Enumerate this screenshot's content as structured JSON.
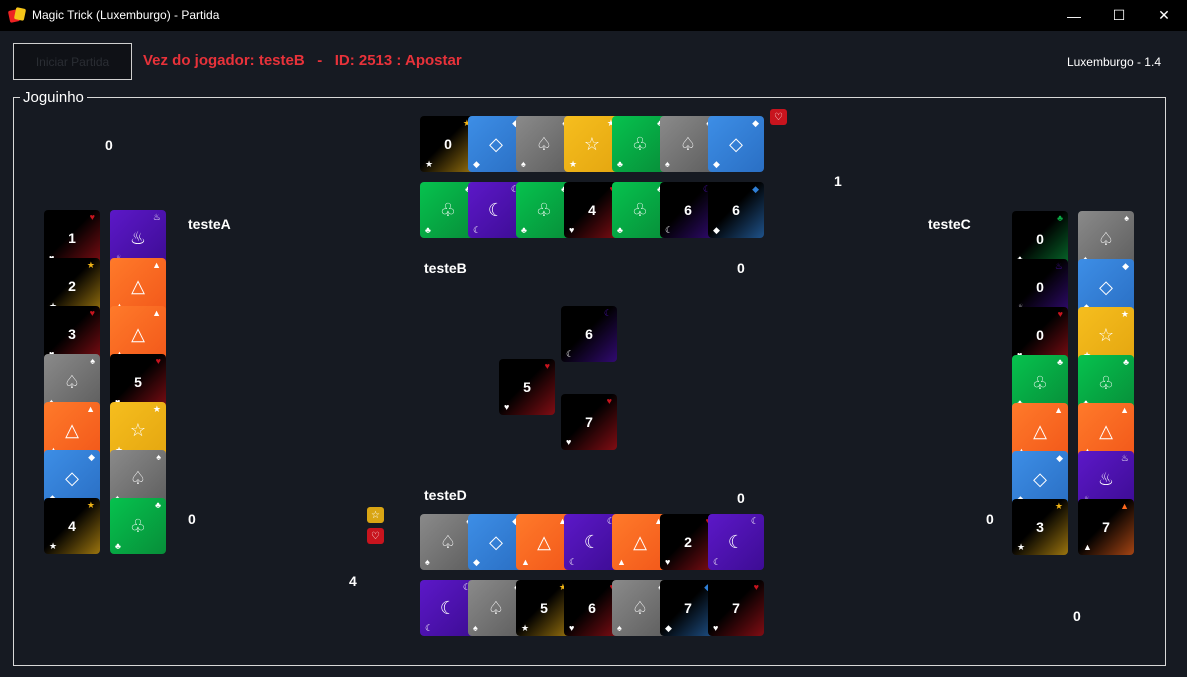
{
  "window": {
    "title": "Magic Trick (Luxemburgo) - Partida",
    "min": "—",
    "max": "☐",
    "close": "✕"
  },
  "toolbar": {
    "start_label": "Iniciar Partida",
    "status": "Vez do jogador: testeB   -   ID: 2513 : Apostar",
    "version": "Luxemburgo - 1.4"
  },
  "board": {
    "group_label": "Joguinho",
    "playerA": {
      "name": "testeA",
      "top_score": "0",
      "side_score": "0",
      "bottom_score": "4"
    },
    "playerB": {
      "name": "testeB",
      "top_score": "1",
      "side_score": "0"
    },
    "playerC": {
      "name": "testeC",
      "side_score": "0",
      "bottom_score": "0"
    },
    "playerD": {
      "name": "testeD",
      "side_score": "0"
    }
  },
  "colors": {
    "red": "#c8141e",
    "green": "#0aa944",
    "gray": "#777",
    "blue": "#2f7fd6",
    "yellow": "#f0b416",
    "orange": "#ff6a1e",
    "purple": "#4c10b0",
    "dark": "#000000"
  },
  "tokens": {
    "top_right": "♡",
    "left_star": "☆",
    "left_heart": "♡"
  },
  "cards": {
    "top_row1": [
      {
        "value": "0",
        "suit": "star",
        "color": "yellow"
      },
      {
        "value": "",
        "suit": "diamond",
        "color": "blue"
      },
      {
        "value": "",
        "suit": "spade",
        "color": "gray"
      },
      {
        "value": "",
        "suit": "star",
        "color": "yellow"
      },
      {
        "value": "",
        "suit": "club",
        "color": "green"
      },
      {
        "value": "",
        "suit": "spade",
        "color": "gray"
      },
      {
        "value": "",
        "suit": "diamond",
        "color": "blue"
      }
    ],
    "top_row2": [
      {
        "value": "",
        "suit": "club",
        "color": "green"
      },
      {
        "value": "",
        "suit": "moon",
        "color": "purple"
      },
      {
        "value": "",
        "suit": "club",
        "color": "green"
      },
      {
        "value": "4",
        "suit": "heart",
        "color": "red"
      },
      {
        "value": "",
        "suit": "club",
        "color": "green"
      },
      {
        "value": "6",
        "suit": "moon",
        "color": "purple"
      },
      {
        "value": "6",
        "suit": "diamond",
        "color": "blue"
      }
    ],
    "left_col1": [
      {
        "value": "1",
        "suit": "heart",
        "color": "red"
      },
      {
        "value": "2",
        "suit": "star",
        "color": "yellow"
      },
      {
        "value": "3",
        "suit": "heart",
        "color": "red"
      },
      {
        "value": "",
        "suit": "spade",
        "color": "gray"
      },
      {
        "value": "",
        "suit": "triangle",
        "color": "orange"
      },
      {
        "value": "",
        "suit": "diamond",
        "color": "blue"
      },
      {
        "value": "4",
        "suit": "star",
        "color": "yellow"
      }
    ],
    "left_col2": [
      {
        "value": "",
        "suit": "drop",
        "color": "purple"
      },
      {
        "value": "",
        "suit": "triangle",
        "color": "orange"
      },
      {
        "value": "",
        "suit": "triangle",
        "color": "orange"
      },
      {
        "value": "5",
        "suit": "heart",
        "color": "red"
      },
      {
        "value": "",
        "suit": "star",
        "color": "yellow"
      },
      {
        "value": "",
        "suit": "spade",
        "color": "gray"
      },
      {
        "value": "",
        "suit": "club",
        "color": "green"
      }
    ],
    "right_col1": [
      {
        "value": "0",
        "suit": "club",
        "color": "green"
      },
      {
        "value": "0",
        "suit": "drop",
        "color": "purple"
      },
      {
        "value": "0",
        "suit": "heart",
        "color": "red"
      },
      {
        "value": "",
        "suit": "club",
        "color": "green"
      },
      {
        "value": "",
        "suit": "triangle",
        "color": "orange"
      },
      {
        "value": "",
        "suit": "diamond",
        "color": "blue"
      },
      {
        "value": "3",
        "suit": "star",
        "color": "yellow"
      }
    ],
    "right_col2": [
      {
        "value": "",
        "suit": "spade",
        "color": "gray"
      },
      {
        "value": "",
        "suit": "diamond",
        "color": "blue"
      },
      {
        "value": "",
        "suit": "star",
        "color": "yellow"
      },
      {
        "value": "",
        "suit": "club",
        "color": "green"
      },
      {
        "value": "",
        "suit": "triangle",
        "color": "orange"
      },
      {
        "value": "",
        "suit": "drop",
        "color": "purple"
      },
      {
        "value": "7",
        "suit": "triangle",
        "color": "orange"
      }
    ],
    "bottom_row1": [
      {
        "value": "",
        "suit": "spade",
        "color": "gray"
      },
      {
        "value": "",
        "suit": "diamond",
        "color": "blue"
      },
      {
        "value": "",
        "suit": "triangle",
        "color": "orange"
      },
      {
        "value": "",
        "suit": "moon",
        "color": "purple"
      },
      {
        "value": "",
        "suit": "triangle",
        "color": "orange"
      },
      {
        "value": "2",
        "suit": "heart",
        "color": "red"
      },
      {
        "value": "",
        "suit": "moon",
        "color": "purple"
      }
    ],
    "bottom_row2": [
      {
        "value": "",
        "suit": "moon",
        "color": "purple"
      },
      {
        "value": "",
        "suit": "spade",
        "color": "gray"
      },
      {
        "value": "5",
        "suit": "star",
        "color": "yellow"
      },
      {
        "value": "6",
        "suit": "heart",
        "color": "red"
      },
      {
        "value": "",
        "suit": "spade",
        "color": "gray"
      },
      {
        "value": "7",
        "suit": "diamond",
        "color": "blue"
      },
      {
        "value": "7",
        "suit": "heart",
        "color": "red"
      }
    ],
    "played": [
      {
        "value": "6",
        "suit": "moon",
        "color": "purple"
      },
      {
        "value": "5",
        "suit": "heart",
        "color": "red"
      },
      {
        "value": "7",
        "suit": "heart",
        "color": "red"
      }
    ]
  }
}
